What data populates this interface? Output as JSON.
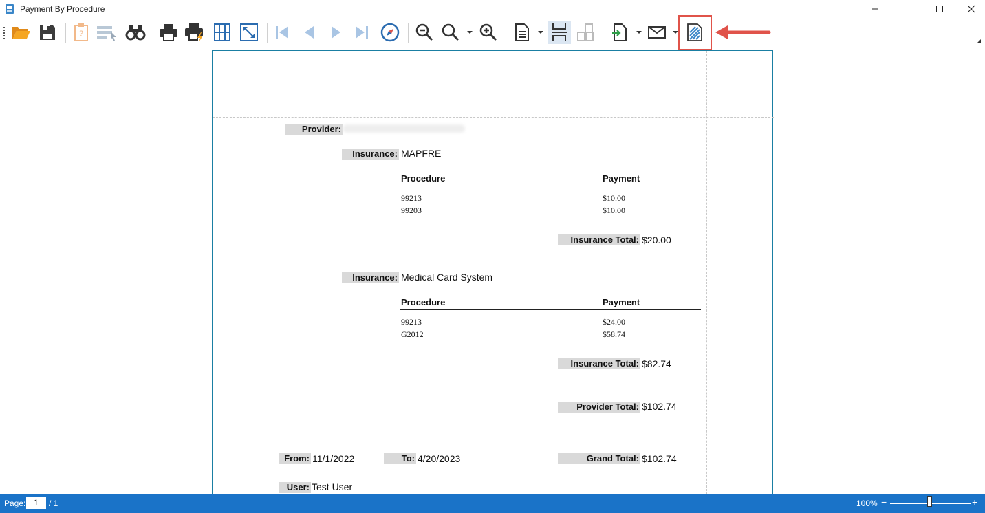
{
  "window": {
    "title": "Payment By Procedure",
    "minimize_icon": "minimize-icon",
    "maximize_icon": "maximize-icon",
    "close_icon": "close-icon"
  },
  "toolbar": {
    "buttons": [
      {
        "icon": "open-folder-icon"
      },
      {
        "icon": "save-icon"
      },
      {
        "icon": "parameters-icon"
      },
      {
        "icon": "select-report-icon"
      },
      {
        "icon": "find-binoculars-icon"
      },
      {
        "icon": "print-icon"
      },
      {
        "icon": "quick-print-icon"
      },
      {
        "icon": "page-setup-grid-icon"
      },
      {
        "icon": "fit-page-icon"
      },
      {
        "icon": "first-page-icon"
      },
      {
        "icon": "previous-page-icon"
      },
      {
        "icon": "next-page-icon"
      },
      {
        "icon": "last-page-icon"
      },
      {
        "icon": "navigate-compass-icon"
      },
      {
        "icon": "zoom-out-icon"
      },
      {
        "icon": "zoom-icon"
      },
      {
        "icon": "zoom-in-icon"
      },
      {
        "icon": "single-page-icon"
      },
      {
        "icon": "continuous-page-icon"
      },
      {
        "icon": "multiple-pages-icon"
      },
      {
        "icon": "export-icon"
      },
      {
        "icon": "email-icon"
      },
      {
        "icon": "watermark-icon"
      }
    ],
    "highlight_color": "#e0534a"
  },
  "report": {
    "provider_label": "Provider:",
    "insurance_groups": [
      {
        "insurance_label": "Insurance:",
        "insurance_name": "MAPFRE",
        "col_procedure": "Procedure",
        "col_payment": "Payment",
        "rows": [
          {
            "procedure": "99213",
            "payment": "$10.00"
          },
          {
            "procedure": "99203",
            "payment": "$10.00"
          }
        ],
        "total_label": "Insurance Total:",
        "total_value": "$20.00"
      },
      {
        "insurance_label": "Insurance:",
        "insurance_name": "Medical Card System",
        "col_procedure": "Procedure",
        "col_payment": "Payment",
        "rows": [
          {
            "procedure": "99213",
            "payment": "$24.00"
          },
          {
            "procedure": "G2012",
            "payment": "$58.74"
          }
        ],
        "total_label": "Insurance Total:",
        "total_value": "$82.74"
      }
    ],
    "provider_total_label": "Provider Total:",
    "provider_total_value": "$102.74",
    "from_label": "From:",
    "from_value": "11/1/2022",
    "to_label": "To:",
    "to_value": "4/20/2023",
    "grand_total_label": "Grand Total:",
    "grand_total_value": "$102.74",
    "user_label": "User:",
    "user_value": "Test User"
  },
  "statusbar": {
    "page_label": "Page:",
    "page_value": "1",
    "page_total": "/ 1",
    "zoom": "100%",
    "zoom_minus": "−",
    "zoom_plus": "+",
    "color": "#1a73c8"
  }
}
